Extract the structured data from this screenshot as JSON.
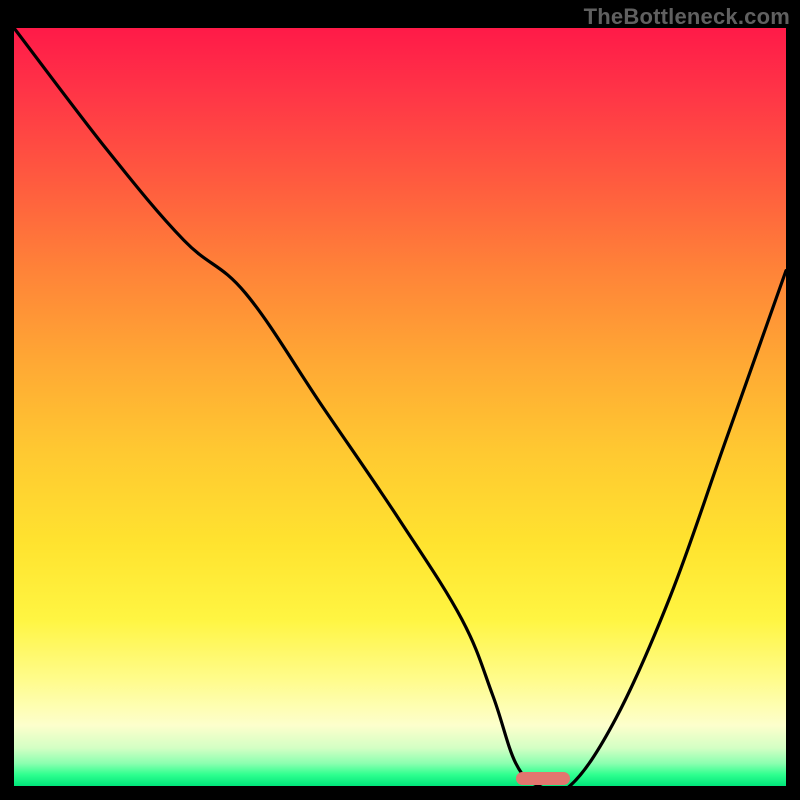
{
  "watermark": {
    "text": "TheBottleneck.com"
  },
  "colors": {
    "gradient_top": "#ff1a48",
    "gradient_bottom": "#00e57a",
    "curve": "#000000",
    "marker": "#e2766f",
    "frame": "#000000"
  },
  "chart_data": {
    "type": "line",
    "title": "",
    "xlabel": "",
    "ylabel": "",
    "xlim": [
      0,
      100
    ],
    "ylim": [
      0,
      100
    ],
    "grid": false,
    "series": [
      {
        "name": "bottleneck-curve",
        "x": [
          0,
          12,
          22,
          30,
          40,
          50,
          58,
          62,
          65,
          68,
          72,
          78,
          85,
          92,
          100
        ],
        "values": [
          100,
          84,
          72,
          65,
          50,
          35,
          22,
          12,
          3,
          0,
          0,
          9,
          25,
          45,
          68
        ]
      }
    ],
    "annotations": [
      {
        "name": "optimal-range-marker",
        "x_start": 65,
        "x_end": 72,
        "y": 0
      }
    ]
  }
}
